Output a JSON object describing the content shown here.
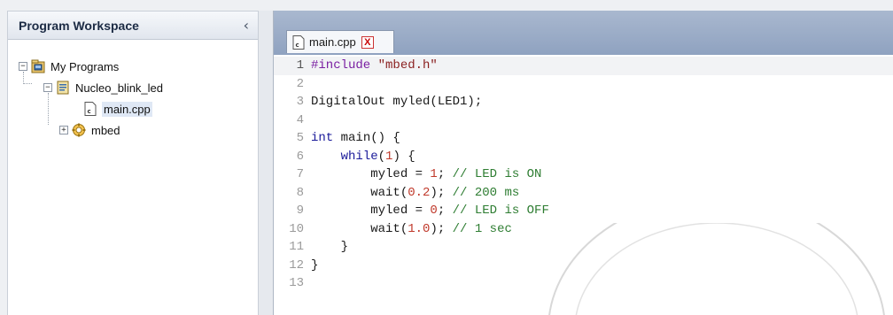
{
  "workspace": {
    "title": "Program Workspace",
    "collapse_glyph": "‹",
    "tree": {
      "root": {
        "label": "My Programs",
        "toggle": "−",
        "icon": "programs-folder-icon"
      },
      "program": {
        "label": "Nucleo_blink_led",
        "toggle": "−",
        "icon": "program-icon"
      },
      "file": {
        "label": "main.cpp",
        "icon": "cpp-file-icon"
      },
      "library": {
        "label": "mbed",
        "toggle": "+",
        "icon": "library-gear-icon"
      }
    }
  },
  "editor": {
    "tab": {
      "label": "main.cpp",
      "close_glyph": "X"
    },
    "current_line": 1,
    "lines": [
      {
        "n": "1",
        "tokens": [
          [
            "pp",
            "#include "
          ],
          [
            "str",
            "\"mbed.h\""
          ]
        ]
      },
      {
        "n": "2",
        "tokens": []
      },
      {
        "n": "3",
        "tokens": [
          [
            "",
            "DigitalOut myled(LED1);"
          ]
        ]
      },
      {
        "n": "4",
        "tokens": []
      },
      {
        "n": "5",
        "tokens": [
          [
            "kw",
            "int"
          ],
          [
            "",
            " main() {"
          ]
        ]
      },
      {
        "n": "6",
        "tokens": [
          [
            "",
            "    "
          ],
          [
            "kw",
            "while"
          ],
          [
            "",
            "("
          ],
          [
            "num",
            "1"
          ],
          [
            "",
            ") {"
          ]
        ]
      },
      {
        "n": "7",
        "tokens": [
          [
            "",
            "        myled = "
          ],
          [
            "num",
            "1"
          ],
          [
            "",
            "; "
          ],
          [
            "cm",
            "// LED is ON"
          ]
        ]
      },
      {
        "n": "8",
        "tokens": [
          [
            "",
            "        wait("
          ],
          [
            "num",
            "0.2"
          ],
          [
            "",
            "); "
          ],
          [
            "cm",
            "// 200 ms"
          ]
        ]
      },
      {
        "n": "9",
        "tokens": [
          [
            "",
            "        myled = "
          ],
          [
            "num",
            "0"
          ],
          [
            "",
            "; "
          ],
          [
            "cm",
            "// LED is OFF"
          ]
        ]
      },
      {
        "n": "10",
        "tokens": [
          [
            "",
            "        wait("
          ],
          [
            "num",
            "1.0"
          ],
          [
            "",
            "); "
          ],
          [
            "cm",
            "// 1 sec"
          ]
        ]
      },
      {
        "n": "11",
        "tokens": [
          [
            "",
            "    }"
          ]
        ]
      },
      {
        "n": "12",
        "tokens": [
          [
            "",
            "}"
          ]
        ]
      },
      {
        "n": "13",
        "tokens": []
      }
    ]
  },
  "colors": {
    "keyword": "#1b1b9a",
    "preprocessor": "#7a1fa2",
    "string": "#8a1f1f",
    "number": "#c0392b",
    "comment": "#2e7d32",
    "close_button": "#c80000"
  }
}
